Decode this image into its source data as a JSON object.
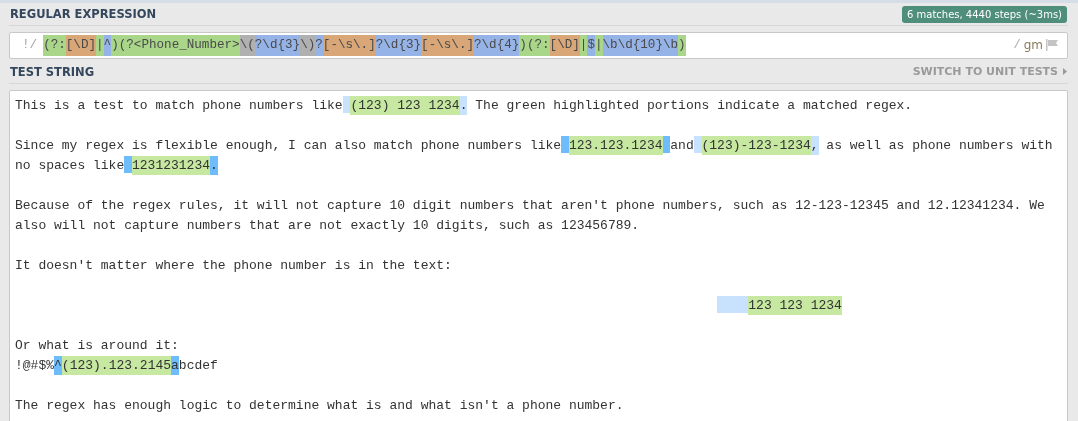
{
  "regex_section": {
    "title": "REGULAR EXPRESSION",
    "badge": "6 matches, 4440 steps (~3ms)",
    "delimiter_open": "!/",
    "tokens": [
      {
        "kind": "group",
        "text": "(?:"
      },
      {
        "kind": "set",
        "text": "[\\D]"
      },
      {
        "kind": "group",
        "text": "|"
      },
      {
        "kind": "token",
        "text": "^"
      },
      {
        "kind": "group",
        "text": ")(?<Phone_Number>"
      },
      {
        "kind": "escape",
        "text": "\\("
      },
      {
        "kind": "token",
        "text": "?\\d{3}"
      },
      {
        "kind": "escape",
        "text": "\\)"
      },
      {
        "kind": "token",
        "text": "?"
      },
      {
        "kind": "set",
        "text": "[-\\s\\.]"
      },
      {
        "kind": "token",
        "text": "?\\d{3}"
      },
      {
        "kind": "set",
        "text": "[-\\s\\.]"
      },
      {
        "kind": "token",
        "text": "?\\d{4}"
      },
      {
        "kind": "group",
        "text": ")(?:"
      },
      {
        "kind": "set",
        "text": "[\\D]"
      },
      {
        "kind": "group",
        "text": "|"
      },
      {
        "kind": "token",
        "text": "$"
      },
      {
        "kind": "group",
        "text": "|"
      },
      {
        "kind": "token",
        "text": "\\b\\d{10}\\b"
      },
      {
        "kind": "group",
        "text": ")"
      }
    ],
    "delimiter_close": "/",
    "flags": "gm"
  },
  "test_section": {
    "title": "TEST STRING",
    "switch_link": "SWITCH TO UNIT TESTS",
    "lines": [
      {
        "kind": "text",
        "segments": [
          {
            "kind": "text",
            "text": "This is a test to match phone numbers like"
          },
          {
            "kind": "edge_space"
          },
          {
            "kind": "match",
            "text": "(123) 123 1234"
          },
          {
            "kind": "edge",
            "text": "."
          },
          {
            "kind": "text",
            "text": " The green highlighted portions indicate a matched regex."
          }
        ]
      },
      {
        "kind": "blank"
      },
      {
        "kind": "text",
        "segments": [
          {
            "kind": "text",
            "text": "Since my regex is flexible enough, I can also match phone numbers like"
          },
          {
            "kind": "strong_space"
          },
          {
            "kind": "match",
            "text": "123.123.1234"
          },
          {
            "kind": "strong_space"
          },
          {
            "kind": "text",
            "text": "and"
          },
          {
            "kind": "edge_space"
          },
          {
            "kind": "match",
            "text": "(123)-123-1234"
          },
          {
            "kind": "edge",
            "text": ","
          },
          {
            "kind": "text",
            "text": " as well as phone numbers with"
          }
        ]
      },
      {
        "kind": "text",
        "segments": [
          {
            "kind": "text",
            "text": "no spaces like"
          },
          {
            "kind": "strong_space"
          },
          {
            "kind": "match",
            "text": "1231231234"
          },
          {
            "kind": "edge_strong",
            "text": "."
          }
        ]
      },
      {
        "kind": "blank"
      },
      {
        "kind": "text",
        "segments": [
          {
            "kind": "text",
            "text": "Because of the regex rules, it will not capture 10 digit numbers that aren't phone numbers, such as 12-123-12345 and 12.12341234. We"
          }
        ]
      },
      {
        "kind": "text",
        "segments": [
          {
            "kind": "text",
            "text": "also will not capture numbers that are not exactly 10 digits, such as 123456789."
          }
        ]
      },
      {
        "kind": "blank"
      },
      {
        "kind": "text",
        "segments": [
          {
            "kind": "text",
            "text": "It doesn't matter where the phone number is in the text:"
          }
        ]
      },
      {
        "kind": "blank"
      },
      {
        "kind": "indented",
        "segments": [
          {
            "kind": "edge_space"
          },
          {
            "kind": "edge_space"
          },
          {
            "kind": "edge_space"
          },
          {
            "kind": "edge_space"
          },
          {
            "kind": "match",
            "text": "123 123 1234"
          }
        ]
      },
      {
        "kind": "blank"
      },
      {
        "kind": "text",
        "segments": [
          {
            "kind": "text",
            "text": "Or what is around it:"
          }
        ]
      },
      {
        "kind": "text",
        "segments": [
          {
            "kind": "text",
            "text": "!@#$%"
          },
          {
            "kind": "edge_strong",
            "text": "^"
          },
          {
            "kind": "match",
            "text": "(123).123.2145"
          },
          {
            "kind": "edge_strong",
            "text": "a"
          },
          {
            "kind": "text",
            "text": "bcdef"
          }
        ]
      },
      {
        "kind": "blank"
      },
      {
        "kind": "text",
        "segments": [
          {
            "kind": "text",
            "text": "The regex has enough logic to determine what is and what isn't a phone number."
          }
        ]
      }
    ]
  }
}
